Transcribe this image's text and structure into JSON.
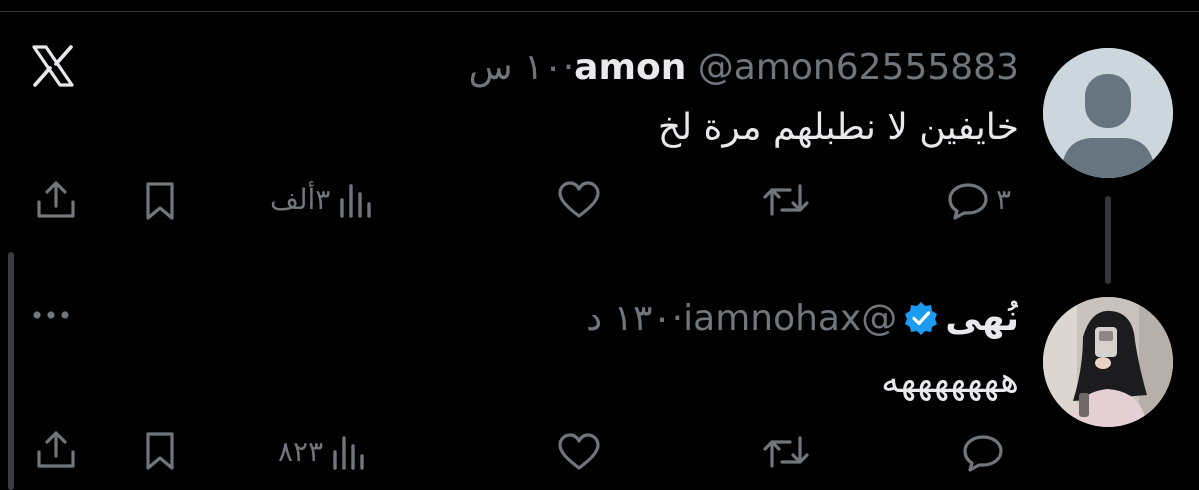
{
  "tweets": [
    {
      "display_name": "amon",
      "handle": "@amon62555883",
      "separator": "·",
      "time": "١٠ س",
      "text": "خايفين لا نطبلهم مرة لخ",
      "replies": "٣",
      "retweets": "",
      "likes": "",
      "views": "٣ألف",
      "verified": false
    },
    {
      "display_name": "نُهى",
      "handle": "@iamnohax",
      "separator": "·",
      "time": "١٣٠ د",
      "text": "هههههههه",
      "replies": "",
      "retweets": "",
      "likes": "",
      "views": "٨٢٣",
      "verified": true
    }
  ],
  "colors": {
    "background": "#000000",
    "text": "#e7e9ea",
    "secondary": "#71767b",
    "verified": "#1d9bf0"
  },
  "icons": [
    "x-logo-icon",
    "more-icon",
    "reply-icon",
    "retweet-icon",
    "like-icon",
    "views-icon",
    "bookmark-icon",
    "share-icon",
    "verified-badge-icon"
  ]
}
